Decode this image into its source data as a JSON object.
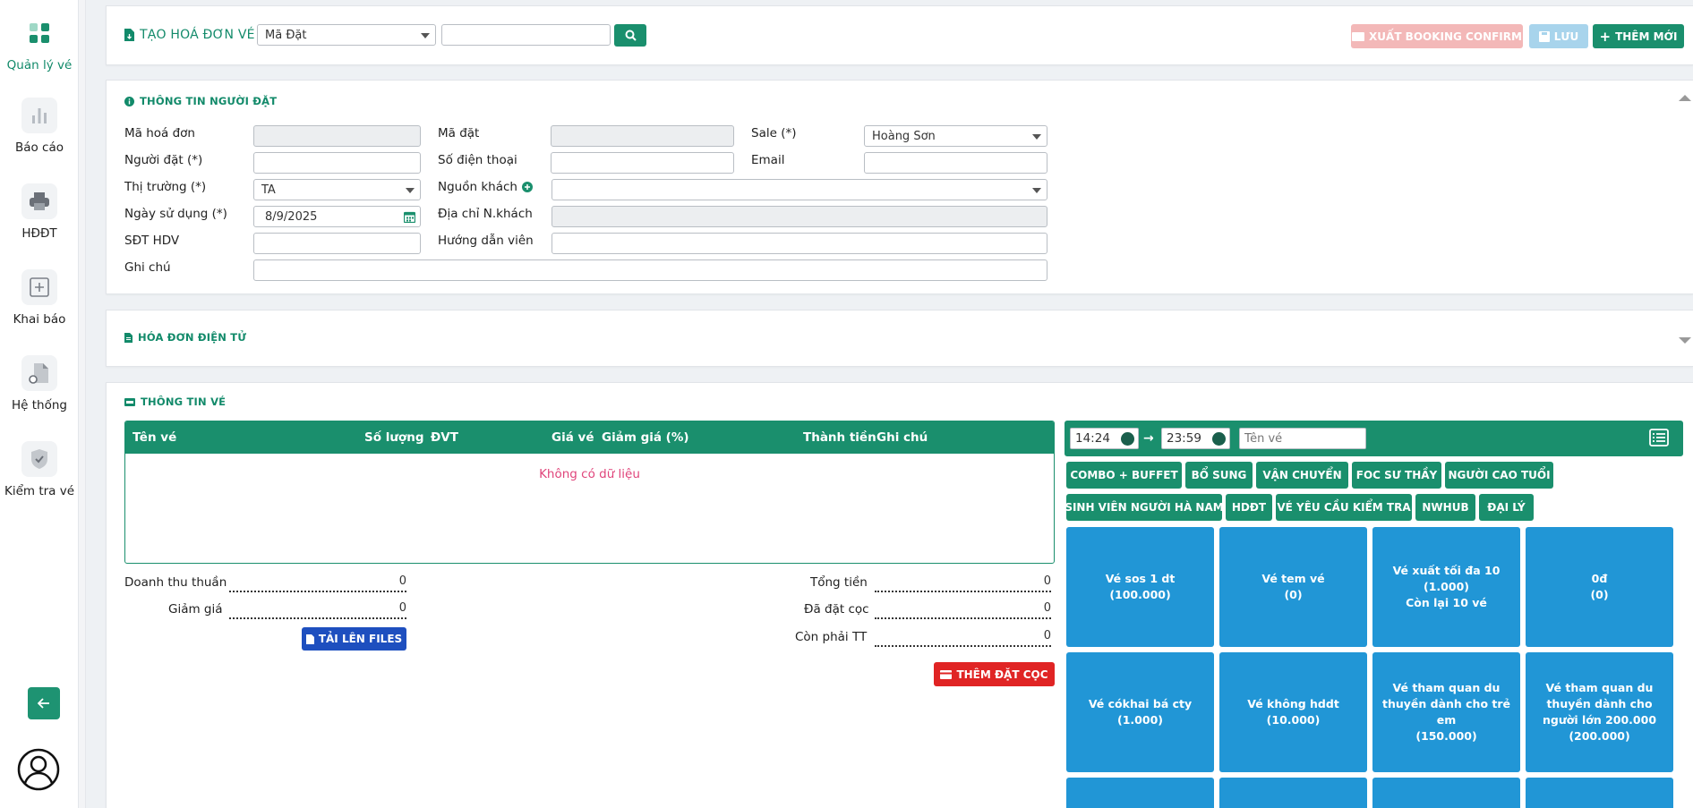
{
  "sidebar": {
    "items": [
      {
        "label": "Quản lý vé",
        "icon": "grid-icon",
        "active": true
      },
      {
        "label": "Báo cáo",
        "icon": "bar-chart-icon"
      },
      {
        "label": "HĐĐT",
        "icon": "printer-icon"
      },
      {
        "label": "Khai báo",
        "icon": "plus-square-icon"
      },
      {
        "label": "Hệ thống",
        "icon": "document-settings-icon"
      },
      {
        "label": "Kiểm tra vé",
        "icon": "shield-check-icon"
      }
    ]
  },
  "header": {
    "title": "TẠO HOÁ ĐƠN VÉ",
    "search_type": "Mã Đặt",
    "search_value": "",
    "export_label": "XUẤT BOOKING CONFIRM",
    "save_label": "LƯU",
    "add_label": "THÊM MỚI"
  },
  "booker": {
    "title": "THÔNG TIN NGƯỜI ĐẶT",
    "invoice_code_label": "Mã hoá đơn",
    "booking_code_label": "Mã đặt",
    "sale_label": "Sale (*)",
    "sale_value": "Hoàng Sơn",
    "booker_label": "Người đặt (*)",
    "phone_label": "Số điện thoại",
    "email_label": "Email",
    "market_label": "Thị trường (*)",
    "market_value": "TA",
    "source_label": "Nguồn khách",
    "source_value": "",
    "use_date_label": "Ngày sử dụng (*)",
    "use_date_value": "8/9/2025",
    "address_label": "Địa chỉ N.khách",
    "guide_phone_label": "SĐT HDV",
    "guide_label": "Hướng dẫn viên",
    "note_label": "Ghi chú"
  },
  "einvoice": {
    "title": "HÓA ĐƠN ĐIỆN TỬ"
  },
  "tickets": {
    "title": "THÔNG TIN VÉ",
    "columns": [
      "Tên vé",
      "Số lượng",
      "ĐVT",
      "Giá vé",
      "Giảm giá (%)",
      "Thành tiền",
      "Ghi chú"
    ],
    "empty_text": "Không có dữ liệu",
    "net_revenue_label": "Doanh thu thuần",
    "net_revenue_value": "0",
    "discount_label": "Giảm giá",
    "discount_value": "0",
    "upload_label": "TẢI LÊN FILES",
    "total_label": "Tổng tiền",
    "total_value": "0",
    "deposit_label": "Đã đặt cọc",
    "deposit_value": "0",
    "remaining_label": "Còn phải TT",
    "remaining_value": "0",
    "add_deposit_label": "THÊM ĐẶT CỌC"
  },
  "picker": {
    "time_from": "14:24",
    "time_to": "23:59",
    "name_placeholder": "Tên vé",
    "categories_row1": [
      "COMBO + BUFFET",
      "BỔ SUNG",
      "VẬN CHUYỂN",
      "FOC SƯ THẦY",
      "NGƯỜI CAO TUỔI"
    ],
    "categories_row2": [
      "SINH VIÊN NGƯỜI HÀ NAM",
      "HDĐT",
      "VÉ YÊU CẦU KIỂM TRA",
      "NWHUB",
      "ĐẠI LÝ"
    ],
    "tiles_row1": [
      [
        "Vé sos 1 dt",
        "(100.000)"
      ],
      [
        "Vé tem vé",
        "(0)"
      ],
      [
        "Vé xuất tối đa 10",
        "(1.000)",
        "Còn lại 10 vé"
      ],
      [
        "0đ",
        "(0)"
      ]
    ],
    "tiles_row2": [
      [
        "Vé cókhai bá cty",
        "(1.000)"
      ],
      [
        "Vé không hddt",
        "(10.000)"
      ],
      [
        "Vé tham quan du thuyền dành cho trẻ em",
        "(150.000)"
      ],
      [
        "Vé tham quan du thuyền dành cho người lớn 200.000",
        "(200.000)"
      ]
    ]
  },
  "colors": {
    "primary": "#1a8f6d",
    "accent_text": "#128a6a",
    "tile": "#2196d6",
    "danger": "#e02424",
    "upload": "#1e4fbf",
    "disabled_export": "#f3b8b8",
    "disabled_save": "#a8d4ec",
    "empty_text": "#e0457b"
  }
}
